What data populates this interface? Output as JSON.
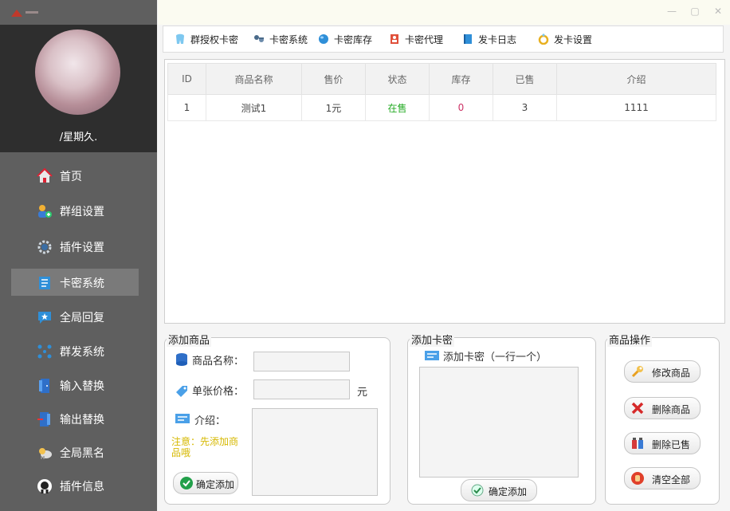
{
  "sidebar": {
    "username": "/星期久.",
    "items": [
      {
        "label": "首页"
      },
      {
        "label": "群组设置"
      },
      {
        "label": "插件设置"
      },
      {
        "label": "卡密系统"
      },
      {
        "label": "全局回复"
      },
      {
        "label": "群发系统"
      },
      {
        "label": "输入替换"
      },
      {
        "label": "输出替换"
      },
      {
        "label": "全局黑名"
      },
      {
        "label": "插件信息"
      }
    ]
  },
  "toolbar": {
    "items": [
      {
        "label": "群授权卡密",
        "icon": "tooth-icon"
      },
      {
        "label": "卡密系统",
        "icon": "keys-icon"
      },
      {
        "label": "卡密库存",
        "icon": "globe-icon"
      },
      {
        "label": "卡密代理",
        "icon": "agent-icon"
      },
      {
        "label": "发卡日志",
        "icon": "book-icon"
      },
      {
        "label": "发卡设置",
        "icon": "ring-icon"
      }
    ]
  },
  "table": {
    "headers": [
      "ID",
      "商品名称",
      "售价",
      "状态",
      "库存",
      "已售",
      "介绍"
    ],
    "rows": [
      [
        "1",
        "测试1",
        "1元",
        "在售",
        "0",
        "3",
        "1111"
      ]
    ]
  },
  "add_product": {
    "title": "添加商品",
    "name_label": "商品名称：",
    "price_label": "单张价格：",
    "unit": "元",
    "intro_label": "介绍：",
    "note": "注意：先添加商品哦",
    "confirm": "确定添加"
  },
  "add_card": {
    "title": "添加卡密",
    "label": "添加卡密（一行一个）",
    "confirm": "确定添加"
  },
  "product_ops": {
    "title": "商品操作",
    "modify": "修改商品",
    "delete": "删除商品",
    "delete_sold": "删除已售",
    "clear_all": "清空全部"
  },
  "colors": {
    "status_on_sale": "#22aa22",
    "stock_zero": "#cc3366",
    "note": "#d6b800",
    "sidebar_bg": "#5f5f5f"
  }
}
